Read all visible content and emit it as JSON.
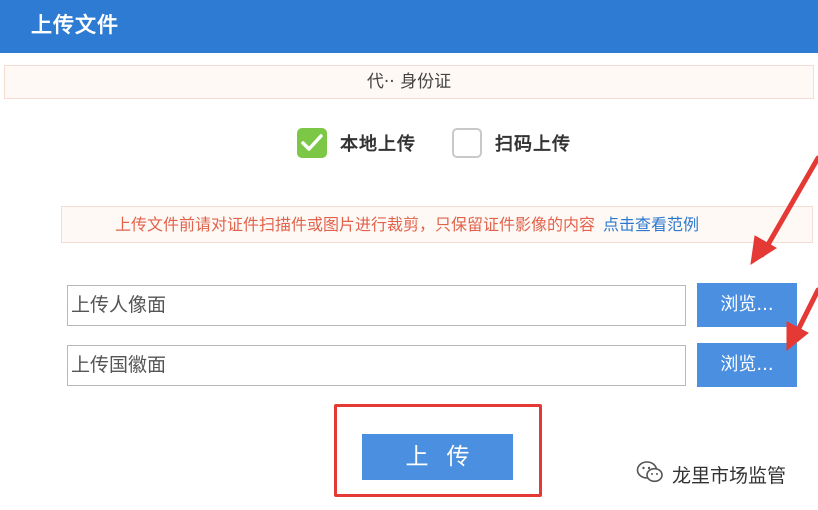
{
  "header": {
    "title": "上传文件"
  },
  "document_type": {
    "label": "代·· 身份证"
  },
  "upload_mode": {
    "options": [
      {
        "label": "本地上传",
        "checked": true
      },
      {
        "label": "扫码上传",
        "checked": false
      }
    ]
  },
  "notice": {
    "text": "上传文件前请对证件扫描件或图片进行裁剪，只保留证件影像的内容",
    "link": "点击查看范例"
  },
  "files": {
    "front": {
      "placeholder": "上传人像面",
      "browse_label": "浏览..."
    },
    "back": {
      "placeholder": "上传国徽面",
      "browse_label": "浏览..."
    }
  },
  "submit": {
    "label": "上传"
  },
  "watermark": {
    "text": "龙里市场监管",
    "icon": "wechat-icon"
  },
  "colors": {
    "header_bg": "#2d7bd3",
    "button_bg": "#4a8fe0",
    "checkbox_checked": "#7cc846",
    "notice_text": "#e2624b",
    "link": "#2b79cf",
    "annotation_red": "#e53935"
  }
}
